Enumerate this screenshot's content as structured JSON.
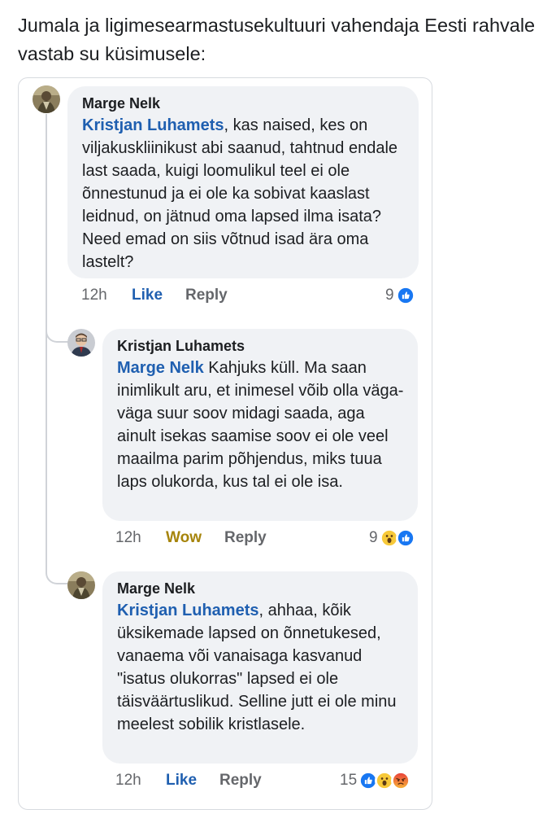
{
  "intro": "Jumala ja ligimesearmastusekultuuri vahendaja Eesti rahvale vastab su küsimusele:",
  "comments": [
    {
      "author": "Marge Nelk",
      "mention": "Kristjan Luhamets",
      "text": ", kas naised, kes on viljakuskliinikust abi saanud, tahtnud endale last saada, kuigi loomulikul teel ei ole õnnestunud ja ei ole ka sobivat kaaslast leidnud, on jätnud oma lapsed ilma isata? Need emad on siis võtnud isad ära oma lastelt?",
      "time": "12h",
      "reaction_label": "Like",
      "reply_label": "Reply",
      "reaction_count": "9"
    },
    {
      "author": "Kristjan Luhamets",
      "mention": "Marge Nelk",
      "text": " Kahjuks küll. Ma saan inimlikult aru, et inimesel võib olla väga-väga suur soov midagi saada, aga ainult isekas saamise soov ei ole veel maailma parim põhjendus, miks tuua laps olukorda, kus tal ei ole isa.",
      "time": "12h",
      "reaction_label": "Wow",
      "reply_label": "Reply",
      "reaction_count": "9"
    },
    {
      "author": "Marge Nelk",
      "mention": "Kristjan Luhamets",
      "text": ", ahhaa, kõik üksikemade lapsed on õnnetukesed, vanaema või vanaisaga kasvanud \"isatus olukorras\" lapsed ei ole täisväärtuslikud. Selline jutt ei ole minu meelest sobilik kristlasele.",
      "time": "12h",
      "reaction_label": "Like",
      "reply_label": "Reply",
      "reaction_count": "15"
    }
  ]
}
